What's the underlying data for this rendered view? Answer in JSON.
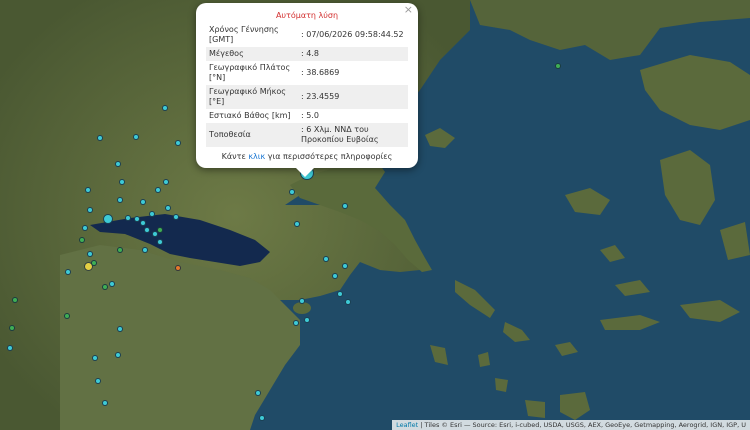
{
  "popup": {
    "title": "Αυτόματη λύση",
    "close_glyph": "×",
    "rows": [
      {
        "label": "Χρόνος Γέννησης [GMT]",
        "value": ": 07/06/2026 09:58:44.52"
      },
      {
        "label": "Μέγεθος",
        "value": ": 4.8"
      },
      {
        "label": "Γεωγραφικό Πλάτος [°N]",
        "value": ": 38.6869"
      },
      {
        "label": "Γεωγραφικό Μήκος [°E]",
        "value": ": 23.4559"
      },
      {
        "label": "Εστιακό Βάθος [km]",
        "value": ": 5.0"
      },
      {
        "label": "Τοποθεσία",
        "value": ": 6 Χλμ. ΝΝΔ του Προκοπίου Ευβοίας"
      }
    ],
    "footer_prefix": "Κάντε ",
    "footer_link": "κλικ",
    "footer_suffix": " για περισσότερες πληροφορίες"
  },
  "attribution": {
    "leaflet": "Leaflet",
    "text": " | Tiles © Esri — Source: Esri, i-cubed, USDA, USGS, AEX, GeoEye, Getmapping, Aerogrid, IGN, IGP, U"
  },
  "colors": {
    "sea": "#1f4a66",
    "gulf": "#152c52",
    "land": "#5b6a3c",
    "popup_title": "#d32f2f",
    "marker_cyan": "#3ecbd6",
    "marker_green": "#3fae55",
    "marker_yellow": "#e3cf43",
    "marker_orange": "#e4782c"
  },
  "icons": {
    "close": "close-icon"
  }
}
